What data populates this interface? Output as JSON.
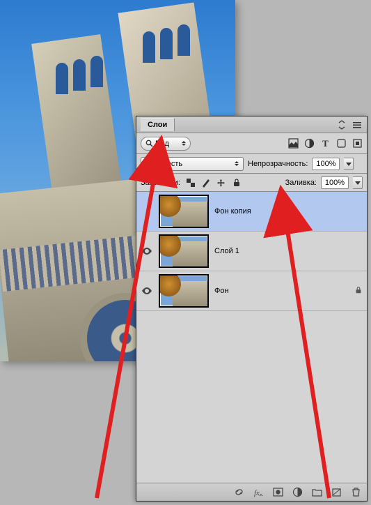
{
  "panel": {
    "title": "Слои",
    "kind_filter": "Вид",
    "blend_mode": "Цветность",
    "opacity_label": "Непрозрачность:",
    "opacity_value": "100%",
    "lock_label": "Закр",
    "lock_partial": "и:",
    "fill_label": "Заливка:",
    "fill_value": "100%"
  },
  "layers": [
    {
      "name": "Фон копия",
      "visible": false,
      "selected": true,
      "locked": false
    },
    {
      "name": "Слой 1",
      "visible": true,
      "selected": false,
      "locked": false
    },
    {
      "name": "Фон",
      "visible": true,
      "selected": false,
      "locked": true
    }
  ],
  "icons": {
    "search": "search-icon",
    "image_filter": "image-filon",
    "adjust": "adjust-icon",
    "text": "text-icon",
    "shape": "shape-icon",
    "smart": "smart-icon"
  }
}
